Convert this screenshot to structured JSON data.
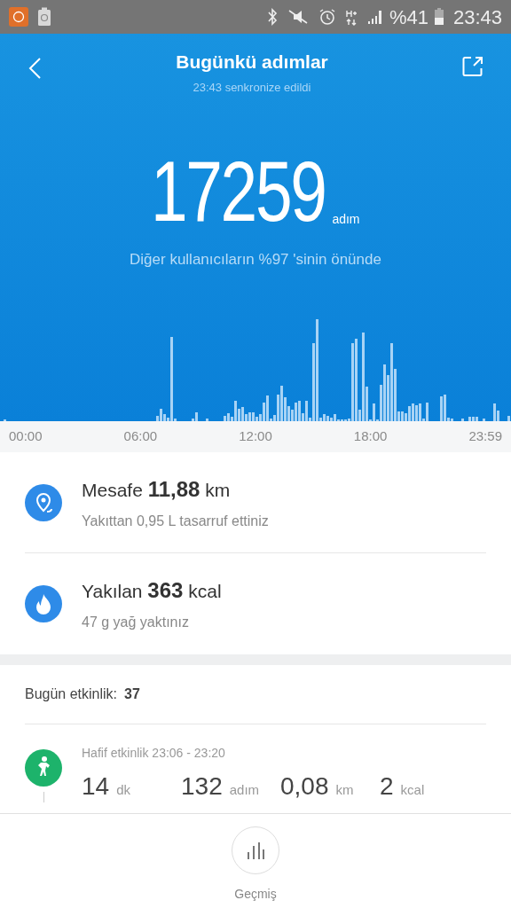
{
  "status_bar": {
    "battery_text": "%41",
    "time": "23:43"
  },
  "header": {
    "title": "Bugünkü adımlar",
    "subtitle": "23:43 senkronize edildi"
  },
  "steps": {
    "value": "17259",
    "unit": "adım",
    "comparison": "Diğer kullanıcıların %97 'sinin önünde"
  },
  "time_axis": [
    "00:00",
    "06:00",
    "12:00",
    "18:00",
    "23:59"
  ],
  "summary": [
    {
      "kind": "distance",
      "title": "Mesafe **11,88** km",
      "subtitle": "Yakıttan 0,95 L tasarruf ettiniz"
    },
    {
      "kind": "calories",
      "title": "Yakılan **363** kcal",
      "subtitle": "47 g yağ yaktınız"
    }
  ],
  "activity": {
    "label": "Bugün etkinlik:",
    "count": "37",
    "items": [
      {
        "title": "Hafif etkinlik 23:06 - 23:20",
        "stats": [
          {
            "value": "14",
            "unit": "dk"
          },
          {
            "value": "132",
            "unit": "adım"
          },
          {
            "value": "0,08",
            "unit": "km"
          },
          {
            "value": "2",
            "unit": "kcal"
          }
        ]
      }
    ]
  },
  "bottom_nav": {
    "label": "Geçmiş"
  }
}
